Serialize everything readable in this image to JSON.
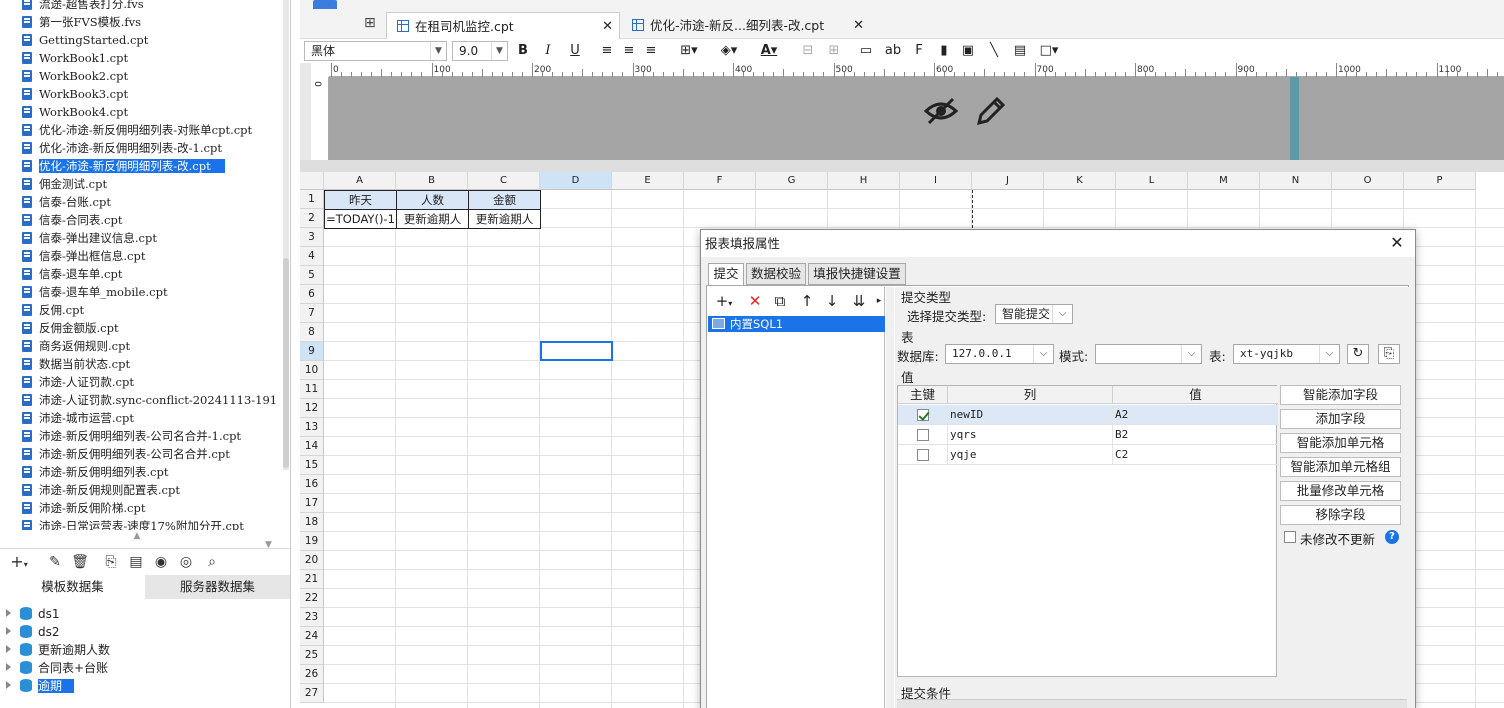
{
  "left_panel": {
    "files": [
      {
        "label": "流途-超售表打分.fvs",
        "selected": false
      },
      {
        "label": "第一张FVS模板.fvs",
        "selected": false
      },
      {
        "label": "GettingStarted.cpt",
        "selected": false
      },
      {
        "label": "WorkBook1.cpt",
        "selected": false
      },
      {
        "label": "WorkBook2.cpt",
        "selected": false
      },
      {
        "label": "WorkBook3.cpt",
        "selected": false
      },
      {
        "label": "WorkBook4.cpt",
        "selected": false
      },
      {
        "label": "优化-沛途-新反佣明细列表-对账单cpt.cpt",
        "selected": false
      },
      {
        "label": "优化-沛途-新反佣明细列表-改-1.cpt",
        "selected": false
      },
      {
        "label": "优化-沛途-新反佣明细列表-改.cpt",
        "selected": true
      },
      {
        "label": "佣金测试.cpt",
        "selected": false
      },
      {
        "label": "信泰-台账.cpt",
        "selected": false
      },
      {
        "label": "信泰-合同表.cpt",
        "selected": false
      },
      {
        "label": "信泰-弹出建议信息.cpt",
        "selected": false
      },
      {
        "label": "信泰-弹出框信息.cpt",
        "selected": false
      },
      {
        "label": "信泰-退车单.cpt",
        "selected": false
      },
      {
        "label": "信泰-退车单_mobile.cpt",
        "selected": false
      },
      {
        "label": "反佣.cpt",
        "selected": false
      },
      {
        "label": "反佣金额版.cpt",
        "selected": false
      },
      {
        "label": "商务返佣规则.cpt",
        "selected": false
      },
      {
        "label": "数据当前状态.cpt",
        "selected": false
      },
      {
        "label": "沛途-人证罚款.cpt",
        "selected": false
      },
      {
        "label": "沛途-人证罚款.sync-conflict-20241113-191",
        "selected": false
      },
      {
        "label": "沛途-城市运营.cpt",
        "selected": false
      },
      {
        "label": "沛途-新反佣明细列表-公司名合并-1.cpt",
        "selected": false
      },
      {
        "label": "沛途-新反佣明细列表-公司名合并.cpt",
        "selected": false
      },
      {
        "label": "沛途-新反佣明细列表.cpt",
        "selected": false
      },
      {
        "label": "沛途-新反佣规则配置表.cpt",
        "selected": false
      },
      {
        "label": "沛途-新反佣阶梯.cpt",
        "selected": false
      },
      {
        "label": "沛途-日常运营表-速度17%附加分开.cpt",
        "selected": false
      }
    ],
    "dataset_tabs": [
      "模板数据集",
      "服务器数据集"
    ],
    "datasets": [
      {
        "label": "ds1",
        "selected": false
      },
      {
        "label": "ds2",
        "selected": false
      },
      {
        "label": "更新逾期人数",
        "selected": false
      },
      {
        "label": "合同表+台账",
        "selected": false
      },
      {
        "label": "逾期",
        "selected": true
      }
    ]
  },
  "tabs": [
    {
      "label": "在租司机监控.cpt",
      "close": "✕"
    },
    {
      "label": "优化-沛途-新反...细列表-改.cpt",
      "close": "✕"
    }
  ],
  "format_bar": {
    "font_name": "黑体",
    "font_size": "9.0",
    "bold": "B",
    "italic": "I",
    "underline": "U"
  },
  "ruler": {
    "ticks": [
      "0",
      "100",
      "200",
      "300",
      "400",
      "500",
      "600",
      "700",
      "800",
      "900",
      "1000",
      "1100"
    ]
  },
  "vruler_label": "0",
  "grid": {
    "columns": [
      "A",
      "B",
      "C",
      "D",
      "E",
      "F",
      "G",
      "H",
      "I",
      "J",
      "K",
      "L",
      "M",
      "N",
      "O",
      "P"
    ],
    "rows": [
      "1",
      "2",
      "3",
      "4",
      "5",
      "6",
      "7",
      "8",
      "9",
      "10",
      "11",
      "12",
      "13",
      "14",
      "15",
      "16",
      "17",
      "18",
      "19",
      "20",
      "21",
      "22",
      "23",
      "24",
      "25",
      "26",
      "27"
    ],
    "cells": {
      "a1": "昨天",
      "b1": "人数",
      "c1": "金额",
      "a2": "=TODAY()-1",
      "b2": "更新逾期人",
      "c2": "更新逾期人"
    }
  },
  "dialog": {
    "title": "报表填报属性",
    "close": "✕",
    "tabs": [
      "提交",
      "数据校验",
      "填报快捷键设置"
    ],
    "list_item": "内置SQL1",
    "submit_type_section": "提交类型",
    "select_submit_type_label": "选择提交类型:",
    "submit_type_value": "智能提交",
    "table_section": "表",
    "database_label": "数据库:",
    "database_value": "127.0.0.1",
    "schema_label": "模式:",
    "schema_value": "",
    "table_label": "表:",
    "table_value": "xt-yqjkb",
    "value_section": "值",
    "columns": [
      "主键",
      "列",
      "值"
    ],
    "rows": [
      {
        "key": true,
        "col": "newID",
        "val": "A2"
      },
      {
        "key": false,
        "col": "yqrs",
        "val": "B2"
      },
      {
        "key": false,
        "col": "yqje",
        "val": "C2"
      }
    ],
    "buttons": [
      "智能添加字段",
      "添加字段",
      "智能添加单元格",
      "智能添加单元格组",
      "批量修改单元格",
      "移除字段"
    ],
    "no_update_unmodified": "未修改不更新",
    "help": "?",
    "submit_condition_section": "提交条件"
  }
}
